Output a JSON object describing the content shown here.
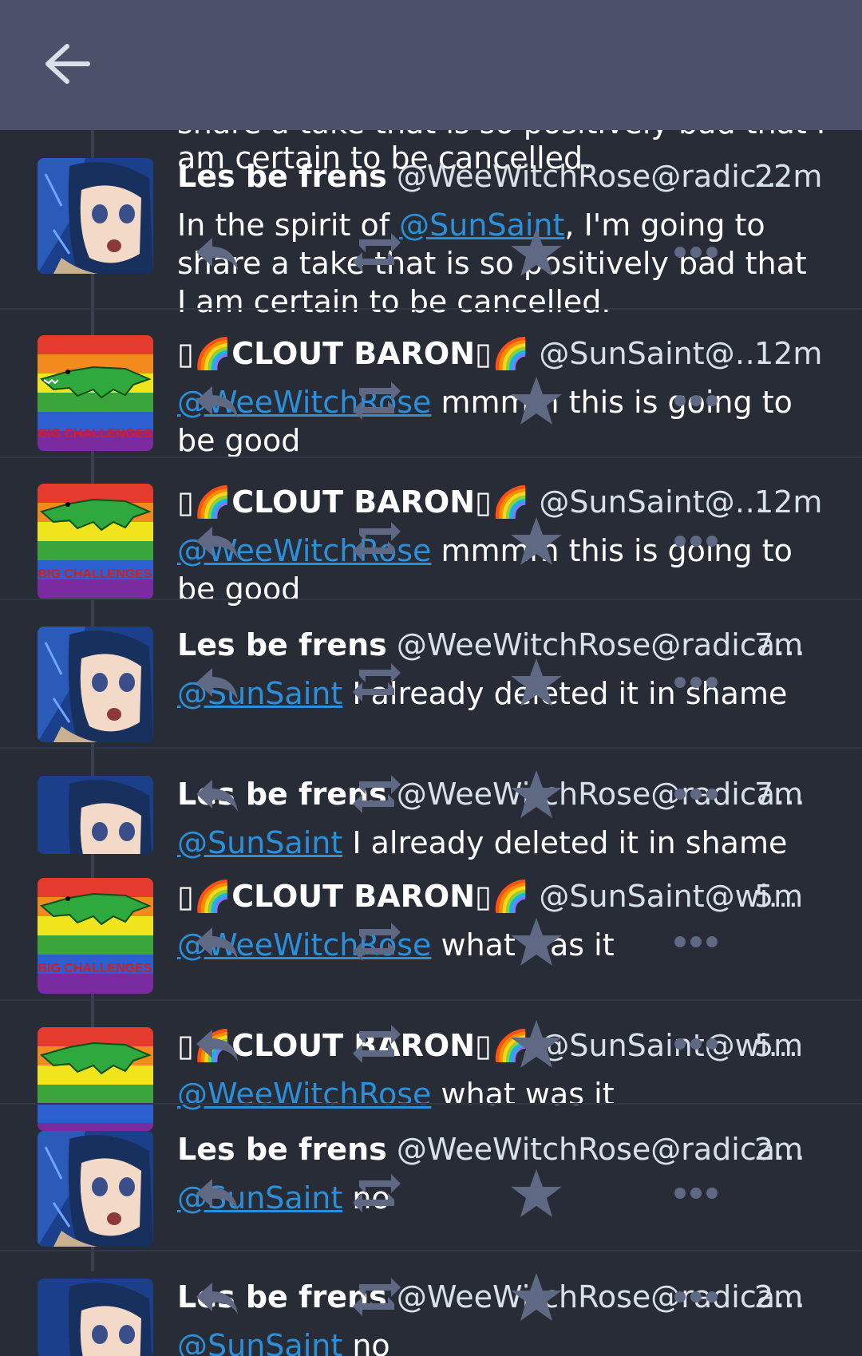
{
  "appbar": {
    "back_icon": "arrow-left-icon"
  },
  "colors": {
    "background": "#282c37",
    "appbar": "#4b5169",
    "mention": "#2b90d9",
    "action": "#606984"
  },
  "statuses": [
    {
      "display_name": "Les be frens",
      "handle": "@WeeWitchRose@radic…",
      "time": "22m",
      "mention": "@SunSaint",
      "text_before": "In the spirit of ",
      "text_after": ", I'm going to share a take that is so positively bad that I am certain to be cancelled.",
      "avatar": "anime-avatar"
    },
    {
      "display_name": "CLOUT BARON",
      "display_prefix": "▯🌈",
      "display_suffix": "▯🌈",
      "handle": "@SunSaint@…",
      "time": "12m",
      "mention": "@WeeWitchRose",
      "text_after": " mmmm this is going to be good",
      "avatar": "rainbow-gator-avatar"
    },
    {
      "display_name": "CLOUT BARON",
      "display_prefix": "▯🌈",
      "display_suffix": "▯🌈",
      "handle": "@SunSaint@…",
      "time": "12m",
      "mention": "@WeeWitchRose",
      "text_after": " mmmm this is going to be good",
      "avatar": "rainbow-gator-avatar"
    },
    {
      "display_name": "Les be frens",
      "handle": "@WeeWitchRose@radica…",
      "time": "7m",
      "mention": "@SunSaint",
      "text_after": " I already deleted it in shame",
      "avatar": "anime-avatar"
    },
    {
      "display_name": "Les be frens",
      "handle": "@WeeWitchRose@radica…",
      "time": "7m",
      "mention": "@SunSaint",
      "text_after": " I already deleted it in shame",
      "avatar": "anime-avatar"
    },
    {
      "display_name": "CLOUT BARON",
      "display_prefix": "▯🌈",
      "display_suffix": "▯🌈",
      "handle": "@SunSaint@wi…",
      "time": "5m",
      "mention": "@WeeWitchRose",
      "text_after": " what was it",
      "avatar": "rainbow-gator-avatar"
    },
    {
      "display_name": "CLOUT BARON",
      "display_prefix": "▯🌈",
      "display_suffix": "▯🌈",
      "handle": "@SunSaint@wi…",
      "time": "5m",
      "mention": "@WeeWitchRose",
      "text_after": " what was it",
      "avatar": "rainbow-gator-avatar"
    },
    {
      "display_name": "Les be frens",
      "handle": "@WeeWitchRose@radica…",
      "time": "2m",
      "mention": "@SunSaint",
      "text_after": " no",
      "avatar": "anime-avatar"
    },
    {
      "display_name": "Les be frens",
      "handle": "@WeeWitchRose@radica…",
      "time": "2m",
      "mention": "@SunSaint",
      "text_after": " no",
      "avatar": "anime-avatar"
    }
  ],
  "ghost_text": {
    "top_line": "share a take that is so positively bad that I",
    "top_line2": "am certain to be cancelled."
  },
  "banner_text": "BIG CHALLENGES",
  "action_icons": [
    "reply-icon",
    "boost-icon",
    "favourite-icon",
    "more-icon"
  ]
}
